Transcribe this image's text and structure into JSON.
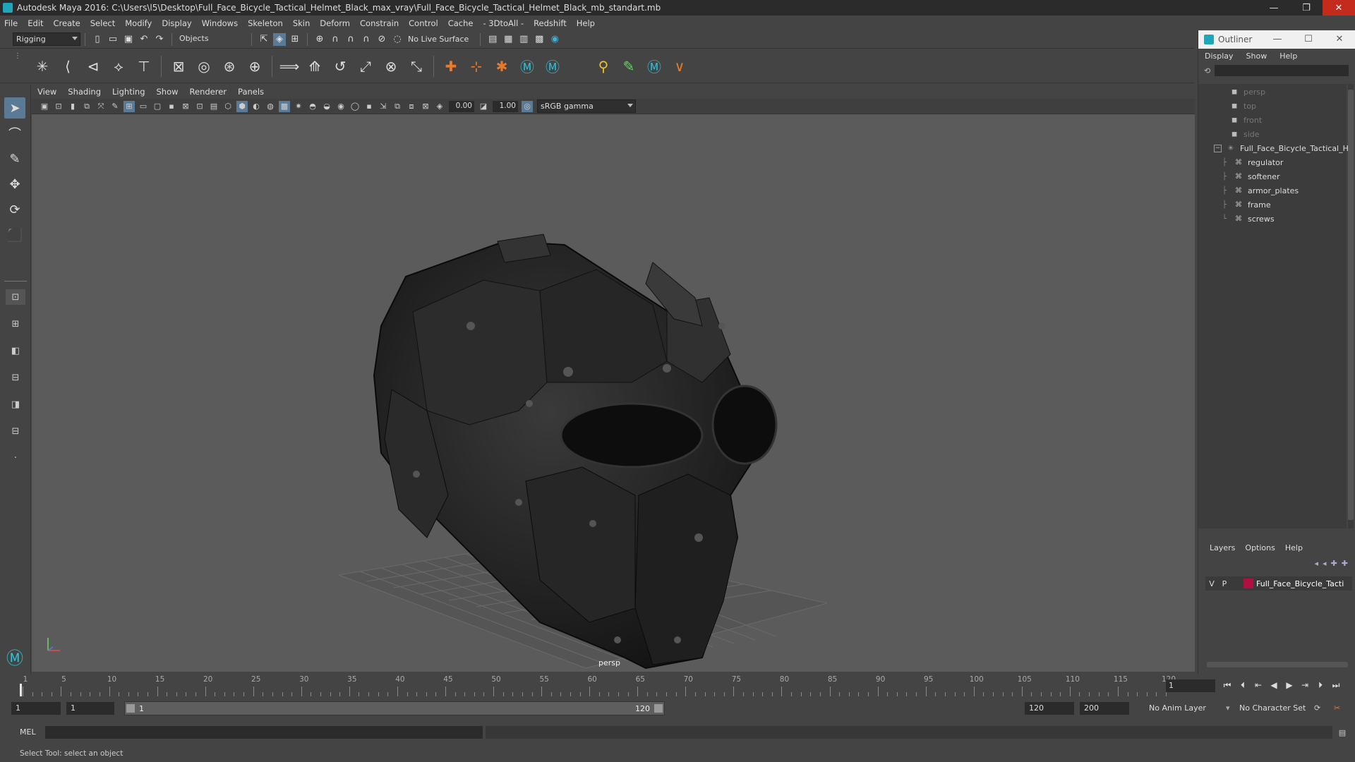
{
  "window": {
    "title": "Autodesk Maya 2016: C:\\Users\\l5\\Desktop\\Full_Face_Bicycle_Tactical_Helmet_Black_max_vray\\Full_Face_Bicycle_Tactical_Helmet_Black_mb_standart.mb",
    "min": "—",
    "max": "❐",
    "close": "✕"
  },
  "menubar": [
    "File",
    "Edit",
    "Create",
    "Select",
    "Modify",
    "Display",
    "Windows",
    "Skeleton",
    "Skin",
    "Deform",
    "Constrain",
    "Control",
    "Cache",
    "- 3DtoAll -",
    "Redshift",
    "Help"
  ],
  "status_line": {
    "menuset": "Rigging",
    "select_mode": "Objects",
    "live_surface": "No Live Surface"
  },
  "viewport": {
    "menu": [
      "View",
      "Shading",
      "Lighting",
      "Show",
      "Renderer",
      "Panels"
    ],
    "exposure": "0.00",
    "gamma": "1.00",
    "color_space": "sRGB gamma",
    "camera_label": "persp"
  },
  "outliner": {
    "title": "Outliner",
    "min": "—",
    "max": "☐",
    "close": "✕",
    "menu": [
      "Display",
      "Show",
      "Help"
    ],
    "items": [
      {
        "label": "persp",
        "kind": "camera"
      },
      {
        "label": "top",
        "kind": "camera"
      },
      {
        "label": "front",
        "kind": "camera"
      },
      {
        "label": "side",
        "kind": "camera"
      },
      {
        "label": "Full_Face_Bicycle_Tactical_He",
        "kind": "group"
      },
      {
        "label": "regulator",
        "kind": "mesh"
      },
      {
        "label": "softener",
        "kind": "mesh"
      },
      {
        "label": "armor_plates",
        "kind": "mesh"
      },
      {
        "label": "frame",
        "kind": "mesh"
      },
      {
        "label": "screws",
        "kind": "mesh"
      }
    ]
  },
  "layers": {
    "menu": [
      "Layers",
      "Options",
      "Help"
    ],
    "row": {
      "v": "V",
      "p": "P",
      "name": "Full_Face_Bicycle_Tacti",
      "color": "#b01040"
    }
  },
  "timeline": {
    "ticks": [
      "1",
      "5",
      "10",
      "15",
      "20",
      "25",
      "30",
      "35",
      "40",
      "45",
      "50",
      "55",
      "60",
      "65",
      "70",
      "75",
      "80",
      "85",
      "90",
      "95",
      "100",
      "105",
      "110",
      "115",
      "120"
    ],
    "current_frame": "1"
  },
  "range": {
    "start": "1",
    "playback_start": "1",
    "slider_start": "1",
    "slider_end": "120",
    "playback_end": "120",
    "end": "200",
    "anim_layer": "No Anim Layer",
    "character_set": "No Character Set"
  },
  "cmdline": {
    "label": "MEL"
  },
  "helpline": {
    "text": "Select Tool: select an object"
  }
}
